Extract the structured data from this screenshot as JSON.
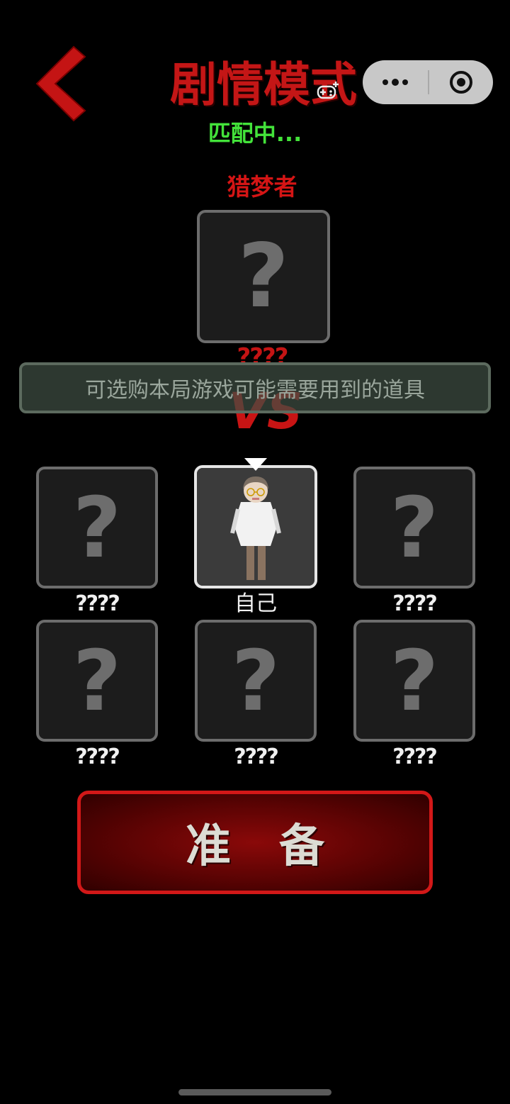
{
  "header": {
    "title": "剧情模式",
    "match_status": "匹配中..."
  },
  "hunter": {
    "role_label": "猎梦者",
    "name": "????"
  },
  "tip": "可选购本局游戏可能需要用到的道具",
  "vs_label": "VS",
  "players": [
    {
      "name": "????",
      "is_self": false
    },
    {
      "name": "自己",
      "is_self": true
    },
    {
      "name": "????",
      "is_self": false
    },
    {
      "name": "????",
      "is_self": false
    },
    {
      "name": "????",
      "is_self": false
    },
    {
      "name": "????",
      "is_self": false
    }
  ],
  "unknown_mark": "?",
  "ready_button": "准备",
  "icons": {
    "back": "chevron-left-icon",
    "more": "more-dots-icon",
    "close": "target-circle-icon",
    "gamepad": "gamepad-icon"
  },
  "colors": {
    "title_red": "#c41616",
    "status_green": "#43e33a",
    "slot_border": "#6c6c6c",
    "ready_border": "#d21818"
  }
}
